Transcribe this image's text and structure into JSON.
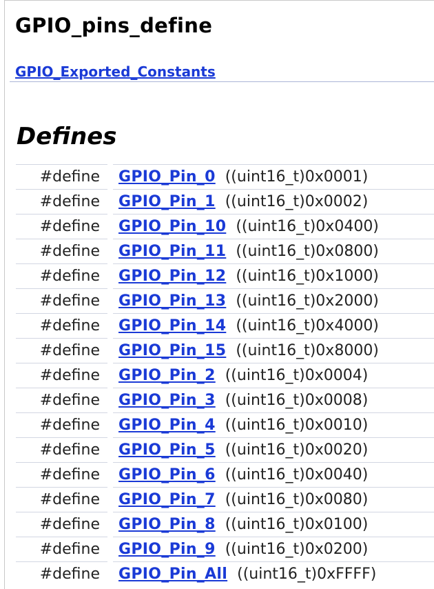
{
  "page": {
    "title": "GPIO_pins_define",
    "module_link": "GPIO_Exported_Constants",
    "section_heading": "Defines"
  },
  "defines": [
    {
      "keyword": "#define",
      "name": "GPIO_Pin_0",
      "value": "((uint16_t)0x0001)"
    },
    {
      "keyword": "#define",
      "name": "GPIO_Pin_1",
      "value": "((uint16_t)0x0002)"
    },
    {
      "keyword": "#define",
      "name": "GPIO_Pin_10",
      "value": "((uint16_t)0x0400)"
    },
    {
      "keyword": "#define",
      "name": "GPIO_Pin_11",
      "value": "((uint16_t)0x0800)"
    },
    {
      "keyword": "#define",
      "name": "GPIO_Pin_12",
      "value": "((uint16_t)0x1000)"
    },
    {
      "keyword": "#define",
      "name": "GPIO_Pin_13",
      "value": "((uint16_t)0x2000)"
    },
    {
      "keyword": "#define",
      "name": "GPIO_Pin_14",
      "value": "((uint16_t)0x4000)"
    },
    {
      "keyword": "#define",
      "name": "GPIO_Pin_15",
      "value": "((uint16_t)0x8000)"
    },
    {
      "keyword": "#define",
      "name": "GPIO_Pin_2",
      "value": "((uint16_t)0x0004)"
    },
    {
      "keyword": "#define",
      "name": "GPIO_Pin_3",
      "value": "((uint16_t)0x0008)"
    },
    {
      "keyword": "#define",
      "name": "GPIO_Pin_4",
      "value": "((uint16_t)0x0010)"
    },
    {
      "keyword": "#define",
      "name": "GPIO_Pin_5",
      "value": "((uint16_t)0x0020)"
    },
    {
      "keyword": "#define",
      "name": "GPIO_Pin_6",
      "value": "((uint16_t)0x0040)"
    },
    {
      "keyword": "#define",
      "name": "GPIO_Pin_7",
      "value": "((uint16_t)0x0080)"
    },
    {
      "keyword": "#define",
      "name": "GPIO_Pin_8",
      "value": "((uint16_t)0x0100)"
    },
    {
      "keyword": "#define",
      "name": "GPIO_Pin_9",
      "value": "((uint16_t)0x0200)"
    },
    {
      "keyword": "#define",
      "name": "GPIO_Pin_All",
      "value": "((uint16_t)0xFFFF)"
    }
  ],
  "colors": {
    "link": "#1a3ad6",
    "rule": "#d2d6e2"
  }
}
